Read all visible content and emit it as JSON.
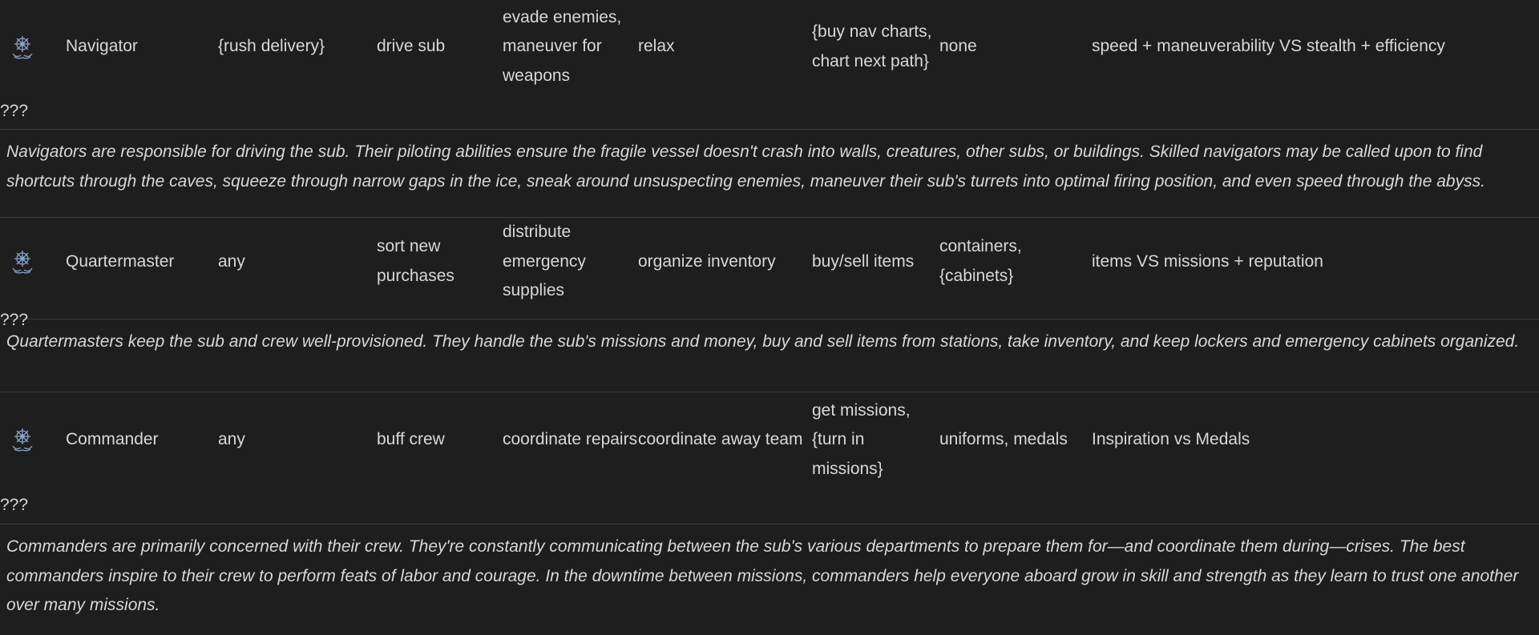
{
  "colors": {
    "background": "#1e1e1e",
    "text": "#d8d8d8",
    "divider": "#3a3a3a",
    "icon": "#8aa4c8"
  },
  "rows": [
    {
      "icon": "ship-wheel-icon",
      "role": "Navigator",
      "col2": "{rush delivery}",
      "col3": "drive sub",
      "col4": "evade enemies, maneuver for weapons",
      "col5": "relax",
      "col6": "{buy nav charts, chart next path}",
      "col7": "none",
      "col8": "speed + maneuverability VS stealth + efficiency",
      "col9": "???",
      "description": "Navigators are responsible for driving the sub. Their piloting abilities ensure the fragile vessel doesn't crash into walls, creatures, other subs, or buildings. Skilled navigators may be called upon to find shortcuts through the caves, squeeze through narrow gaps in the ice, sneak around unsuspecting enemies, maneuver their sub's turrets into optimal firing position, and even speed through the abyss."
    },
    {
      "icon": "ship-wheel-icon",
      "role": "Quartermaster",
      "col2": "any",
      "col3": "sort new purchases",
      "col4": "distribute emergency supplies",
      "col5": "organize inventory",
      "col6": "buy/sell items",
      "col7": "containers, {cabinets}",
      "col8": "items VS missions + reputation",
      "col9": "???",
      "description": "Quartermasters keep the sub and crew well-provisioned. They handle the sub's missions and money, buy and sell items from stations, take inventory, and keep lockers and emergency cabinets organized."
    },
    {
      "icon": "ship-wheel-icon",
      "role": "Commander",
      "col2": "any",
      "col3": "buff crew",
      "col4": "coordinate repairs",
      "col5": "coordinate away team",
      "col6": "get missions, {turn in missions}",
      "col7": "uniforms, medals",
      "col8": "Inspiration vs Medals",
      "col9": "???",
      "description": "Commanders are primarily concerned with their crew. They're constantly communicating between the sub's various departments to prepare them for—and coordinate them during—crises. The best commanders inspire to their crew to perform feats of labor and courage. In the downtime between missions, commanders help everyone aboard grow in skill and strength as they learn to trust one another over many missions."
    }
  ]
}
